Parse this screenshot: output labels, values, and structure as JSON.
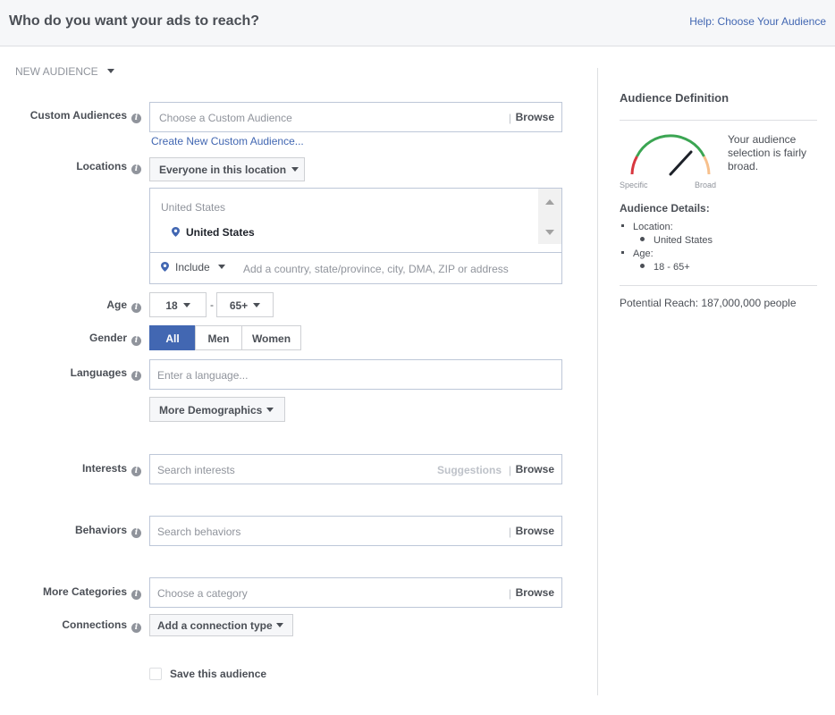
{
  "header": {
    "title": "Who do you want your ads to reach?",
    "help_link": "Help: Choose Your Audience"
  },
  "audience_selector": {
    "label": "NEW AUDIENCE"
  },
  "form": {
    "custom_audiences": {
      "label": "Custom Audiences",
      "placeholder": "Choose a Custom Audience",
      "browse": "Browse",
      "create_link": "Create New Custom Audience..."
    },
    "locations": {
      "label": "Locations",
      "dropdown": "Everyone in this location",
      "country_header": "United States",
      "selected": "United States",
      "include": "Include",
      "placeholder": "Add a country, state/province, city, DMA, ZIP or address"
    },
    "age": {
      "label": "Age",
      "min": "18",
      "separator": "-",
      "max": "65+"
    },
    "gender": {
      "label": "Gender",
      "options": [
        "All",
        "Men",
        "Women"
      ],
      "selected": "All"
    },
    "languages": {
      "label": "Languages",
      "placeholder": "Enter a language..."
    },
    "more_demographics": "More Demographics",
    "interests": {
      "label": "Interests",
      "placeholder": "Search interests",
      "suggestions": "Suggestions",
      "browse": "Browse"
    },
    "behaviors": {
      "label": "Behaviors",
      "placeholder": "Search behaviors",
      "browse": "Browse"
    },
    "more_categories": {
      "label": "More Categories",
      "placeholder": "Choose a category",
      "browse": "Browse"
    },
    "connections": {
      "label": "Connections",
      "dropdown": "Add a connection type"
    },
    "save_audience": "Save this audience"
  },
  "panel": {
    "title": "Audience Definition",
    "gauge": {
      "specific_label": "Specific",
      "broad_label": "Broad",
      "colors": [
        "#d8373f",
        "#3ba552",
        "#f7c08c"
      ]
    },
    "description": "Your audience selection is fairly broad.",
    "details_title": "Audience Details:",
    "details": [
      {
        "label": "Location:",
        "values": [
          "United States"
        ]
      },
      {
        "label": "Age:",
        "values": [
          "18 - 65+"
        ]
      }
    ],
    "potential_reach": "Potential Reach: 187,000,000 people"
  },
  "colors": {
    "accent": "#4267b2",
    "header_bg": "#f6f7f9"
  }
}
